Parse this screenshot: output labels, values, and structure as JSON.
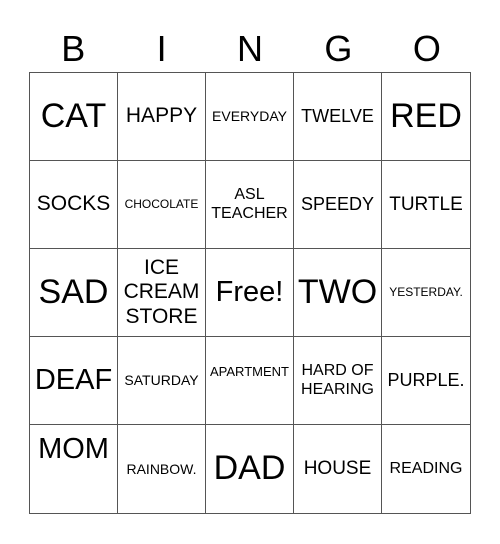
{
  "header": {
    "letters": [
      "B",
      "I",
      "N",
      "G",
      "O"
    ]
  },
  "card": {
    "rows": [
      [
        "CAT",
        "HAPPY",
        "EVERYDAY",
        "TWELVE",
        "RED"
      ],
      [
        "SOCKS",
        "CHOCOLATE",
        "ASL TEACHER",
        "SPEEDY",
        "TURTLE"
      ],
      [
        "SAD",
        "ICE CREAM STORE",
        "Free!",
        "TWO",
        "YESTERDAY."
      ],
      [
        "DEAF",
        "SATURDAY",
        "APARTMENT",
        "HARD OF HEARING",
        "PURPLE."
      ],
      [
        "MOM",
        "RAINBOW.",
        "DAD",
        "HOUSE",
        "READING"
      ]
    ],
    "free_space": "Free!"
  }
}
